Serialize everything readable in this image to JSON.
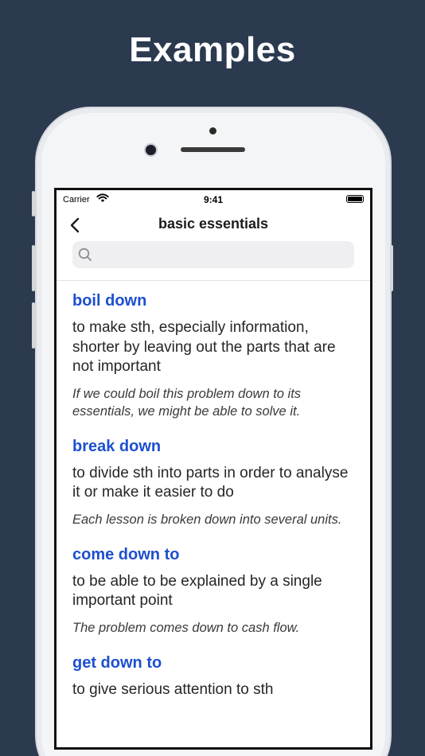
{
  "headline": "Examples",
  "status_bar": {
    "carrier": "Carrier",
    "time": "9:41"
  },
  "nav": {
    "title": "basic essentials",
    "back_icon": "chevron-left-icon"
  },
  "search": {
    "placeholder": "",
    "icon": "search-icon"
  },
  "entries": [
    {
      "term": "boil down",
      "definition": "to make sth, especially information, shorter by leaving out the parts that are not important",
      "example": "If we could boil this problem down to its essentials, we might be able to solve it."
    },
    {
      "term": "break down",
      "definition": "to divide sth into parts in order to analyse it or make it easier to do",
      "example": "Each lesson is broken down into several units."
    },
    {
      "term": "come down to",
      "definition": "to be able to be explained by a single important point",
      "example": "The problem comes down to cash flow."
    },
    {
      "term": "get down to",
      "definition": "to give serious attention to sth",
      "example": ""
    }
  ],
  "colors": {
    "background": "#2c3a50",
    "term": "#1d4fd0",
    "definition": "#262626"
  }
}
